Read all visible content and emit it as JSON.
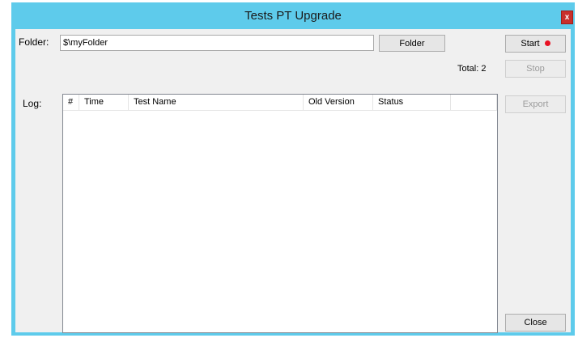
{
  "window": {
    "title": "Tests PT Upgrade",
    "close_glyph": "x"
  },
  "folder": {
    "label": "Folder:",
    "value": "$\\myFolder",
    "browse_label": "Folder"
  },
  "buttons": {
    "start": "Start",
    "stop": "Stop",
    "export": "Export",
    "close": "Close"
  },
  "total": "Total: 2",
  "log": {
    "label": "Log:",
    "columns": [
      "#",
      "Time",
      "Test Name",
      "Old Version",
      "Status",
      ""
    ]
  },
  "colors": {
    "titlebar": "#5ecbeb",
    "start_indicator": "#e81123",
    "close_button": "#c9302c"
  },
  "icons": {
    "close": "close-icon",
    "start_indicator": "red-dot-icon"
  }
}
